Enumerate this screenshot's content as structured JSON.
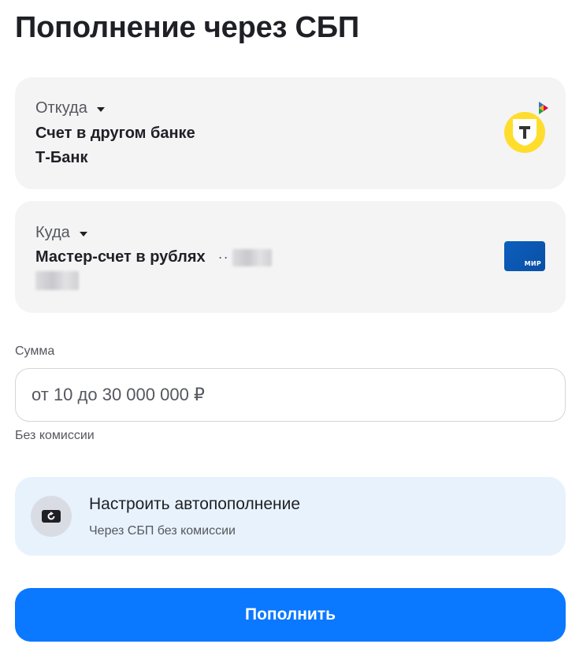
{
  "page": {
    "title": "Пополнение через СБП"
  },
  "from": {
    "label": "Откуда",
    "account": "Счет в другом банке",
    "bank": "Т-Банк",
    "logo_icon": "t-bank-logo",
    "badge_icon": "sbp-logo-icon",
    "logo_color": "#ffdd2d"
  },
  "to": {
    "label": "Куда",
    "account": "Мастер-счет в рублях",
    "masked_prefix": "··",
    "card_icon": "mir-card-icon",
    "card_brand": "МИР",
    "card_color": "#0c5fbd"
  },
  "amount": {
    "label": "Сумма",
    "placeholder": "от 10 до 30 000 000 ₽",
    "value": "",
    "hint": "Без комиссии"
  },
  "autotopup": {
    "title": "Настроить автопополнение",
    "subtitle": "Через СБП без комиссии",
    "icon": "auto-refresh-icon",
    "background": "#e8f2fd"
  },
  "submit": {
    "label": "Пополнить",
    "color": "#0a78ff"
  }
}
